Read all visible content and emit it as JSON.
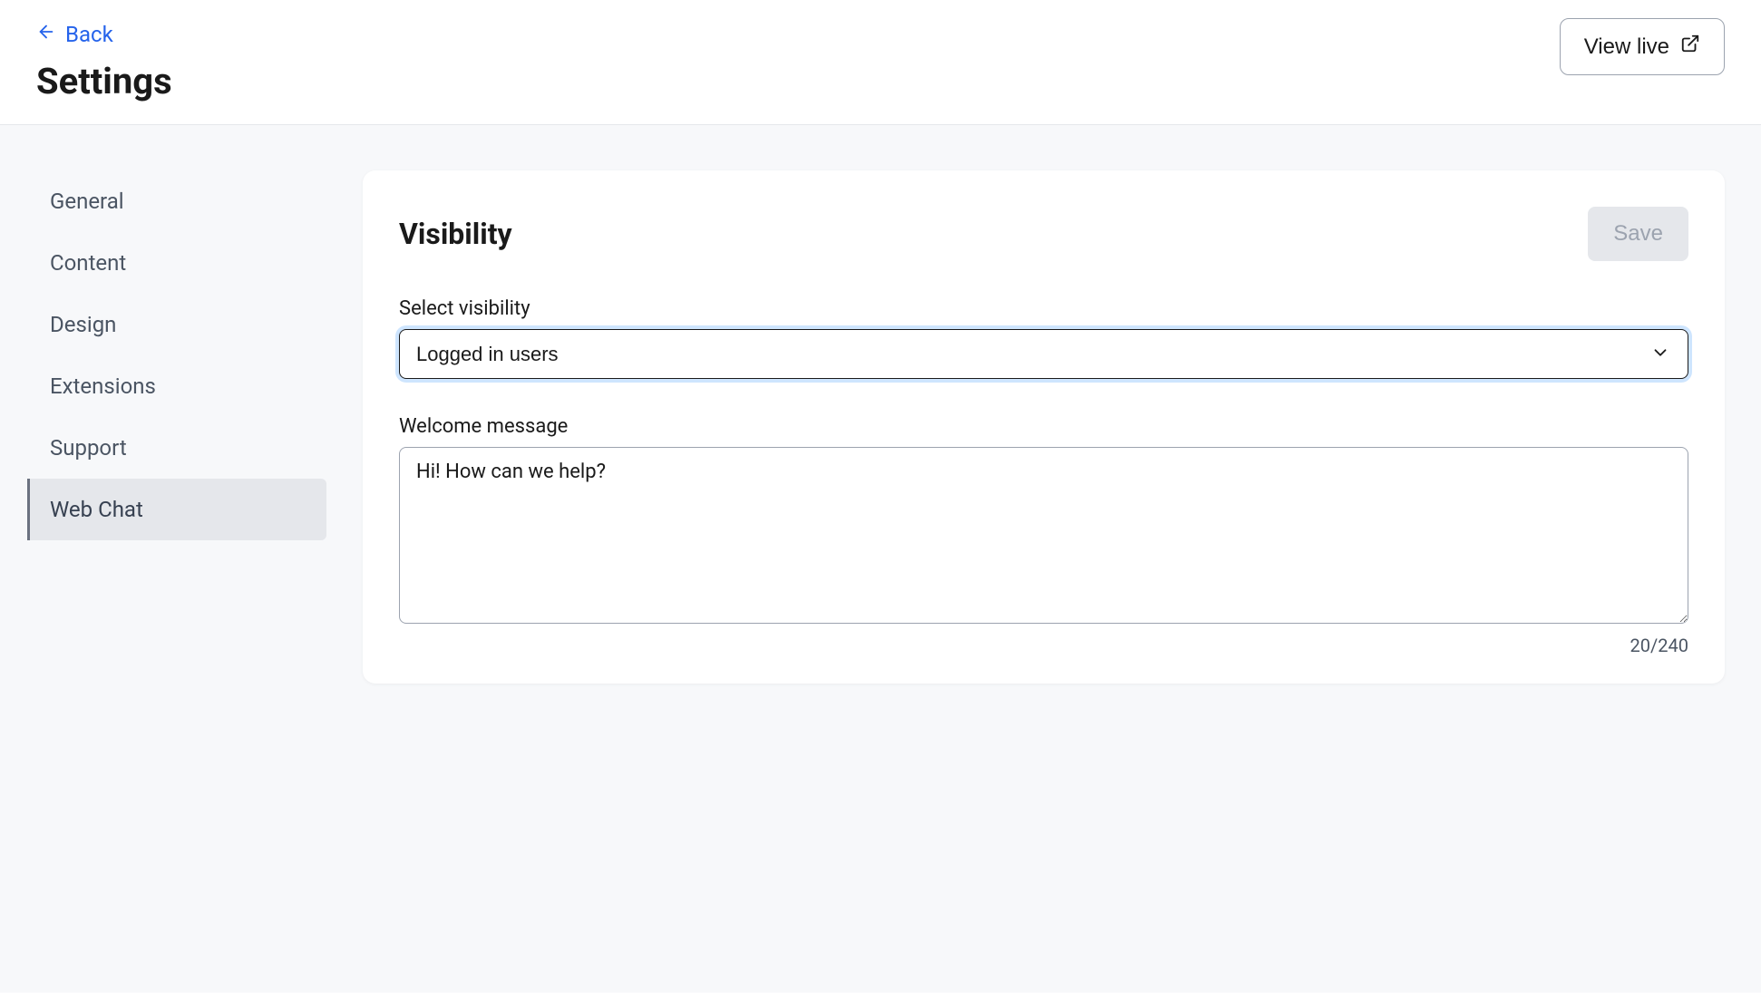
{
  "header": {
    "back_label": "Back",
    "page_title": "Settings",
    "view_live_label": "View live"
  },
  "sidebar": {
    "items": [
      {
        "label": "General",
        "active": false
      },
      {
        "label": "Content",
        "active": false
      },
      {
        "label": "Design",
        "active": false
      },
      {
        "label": "Extensions",
        "active": false
      },
      {
        "label": "Support",
        "active": false
      },
      {
        "label": "Web Chat",
        "active": true
      }
    ]
  },
  "card": {
    "title": "Visibility",
    "save_label": "Save",
    "visibility_field": {
      "label": "Select visibility",
      "value": "Logged in users"
    },
    "welcome_field": {
      "label": "Welcome message",
      "value": "Hi! How can we help?",
      "char_count": "20/240"
    }
  }
}
